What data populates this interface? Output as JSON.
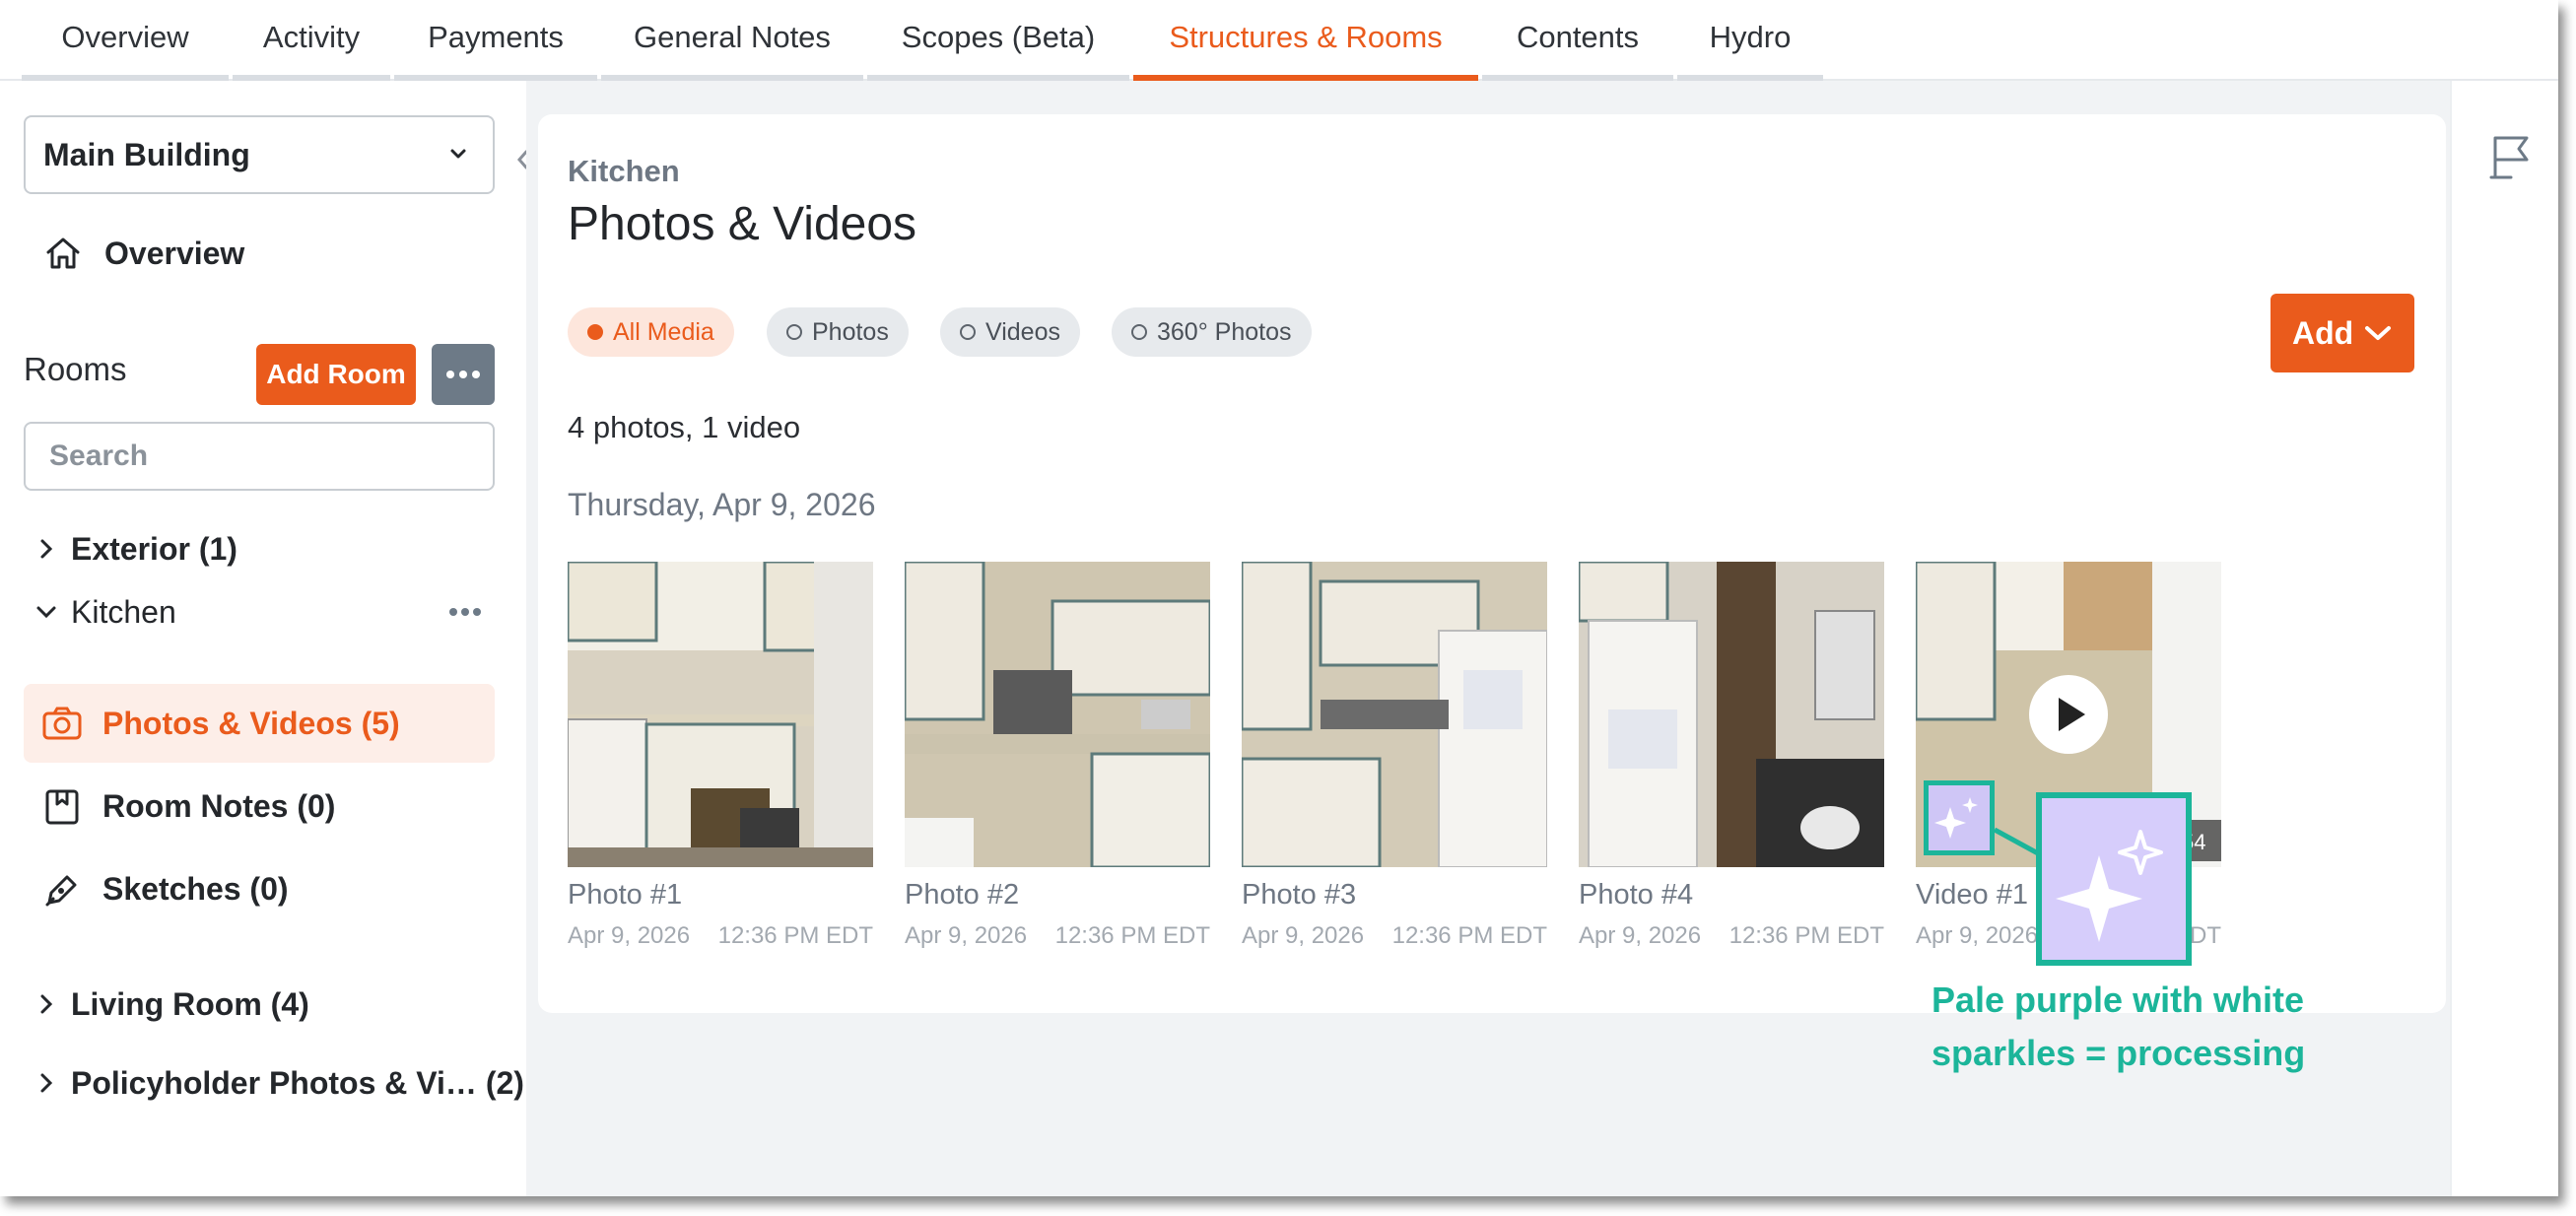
{
  "tabs": [
    {
      "label": "Overview",
      "active": false
    },
    {
      "label": "Activity",
      "active": false
    },
    {
      "label": "Payments",
      "active": false
    },
    {
      "label": "General Notes",
      "active": false
    },
    {
      "label": "Scopes (Beta)",
      "active": false
    },
    {
      "label": "Structures & Rooms",
      "active": true
    },
    {
      "label": "Contents",
      "active": false
    },
    {
      "label": "Hydro",
      "active": false
    }
  ],
  "sidebar": {
    "building_select": "Main Building",
    "overview_label": "Overview",
    "rooms_label": "Rooms",
    "add_room_label": "Add Room",
    "search_placeholder": "Search",
    "tree": {
      "exterior": "Exterior (1)",
      "kitchen": "Kitchen",
      "kitchen_items": {
        "photos": "Photos & Videos (5)",
        "notes": "Room Notes (0)",
        "sketches": "Sketches (0)"
      },
      "living_room": "Living Room (4)",
      "policyholder": "Policyholder Photos & Vi… (2)"
    }
  },
  "main": {
    "breadcrumb": "Kitchen",
    "title": "Photos & Videos",
    "filters": [
      {
        "label": "All Media",
        "active": true
      },
      {
        "label": "Photos",
        "active": false
      },
      {
        "label": "Videos",
        "active": false
      },
      {
        "label": "360° Photos",
        "active": false
      }
    ],
    "add_label": "Add",
    "count_text": "4 photos, 1 video",
    "date_heading": "Thursday, Apr 9, 2026",
    "media": [
      {
        "label": "Photo #1",
        "date": "Apr 9, 2026",
        "time": "12:36 PM EDT"
      },
      {
        "label": "Photo #2",
        "date": "Apr 9, 2026",
        "time": "12:36 PM EDT"
      },
      {
        "label": "Photo #3",
        "date": "Apr 9, 2026",
        "time": "12:36 PM EDT"
      },
      {
        "label": "Photo #4",
        "date": "Apr 9, 2026",
        "time": "12:36 PM EDT"
      },
      {
        "label": "Video #1",
        "date": "Apr 9, 2026",
        "time": "EDT",
        "duration": "54"
      }
    ]
  },
  "annotation": {
    "text": "Pale purple with white sparkles = processing"
  },
  "colors": {
    "accent": "#ea5b1c",
    "annotation": "#1cb59a",
    "processing": "#d6cdfb"
  },
  "icons": {
    "overview": "home-icon",
    "photos": "camera-icon",
    "notes": "note-icon",
    "sketches": "pen-icon",
    "rail": "flag-icon",
    "processing": "sparkles-icon",
    "video": "play-icon"
  }
}
